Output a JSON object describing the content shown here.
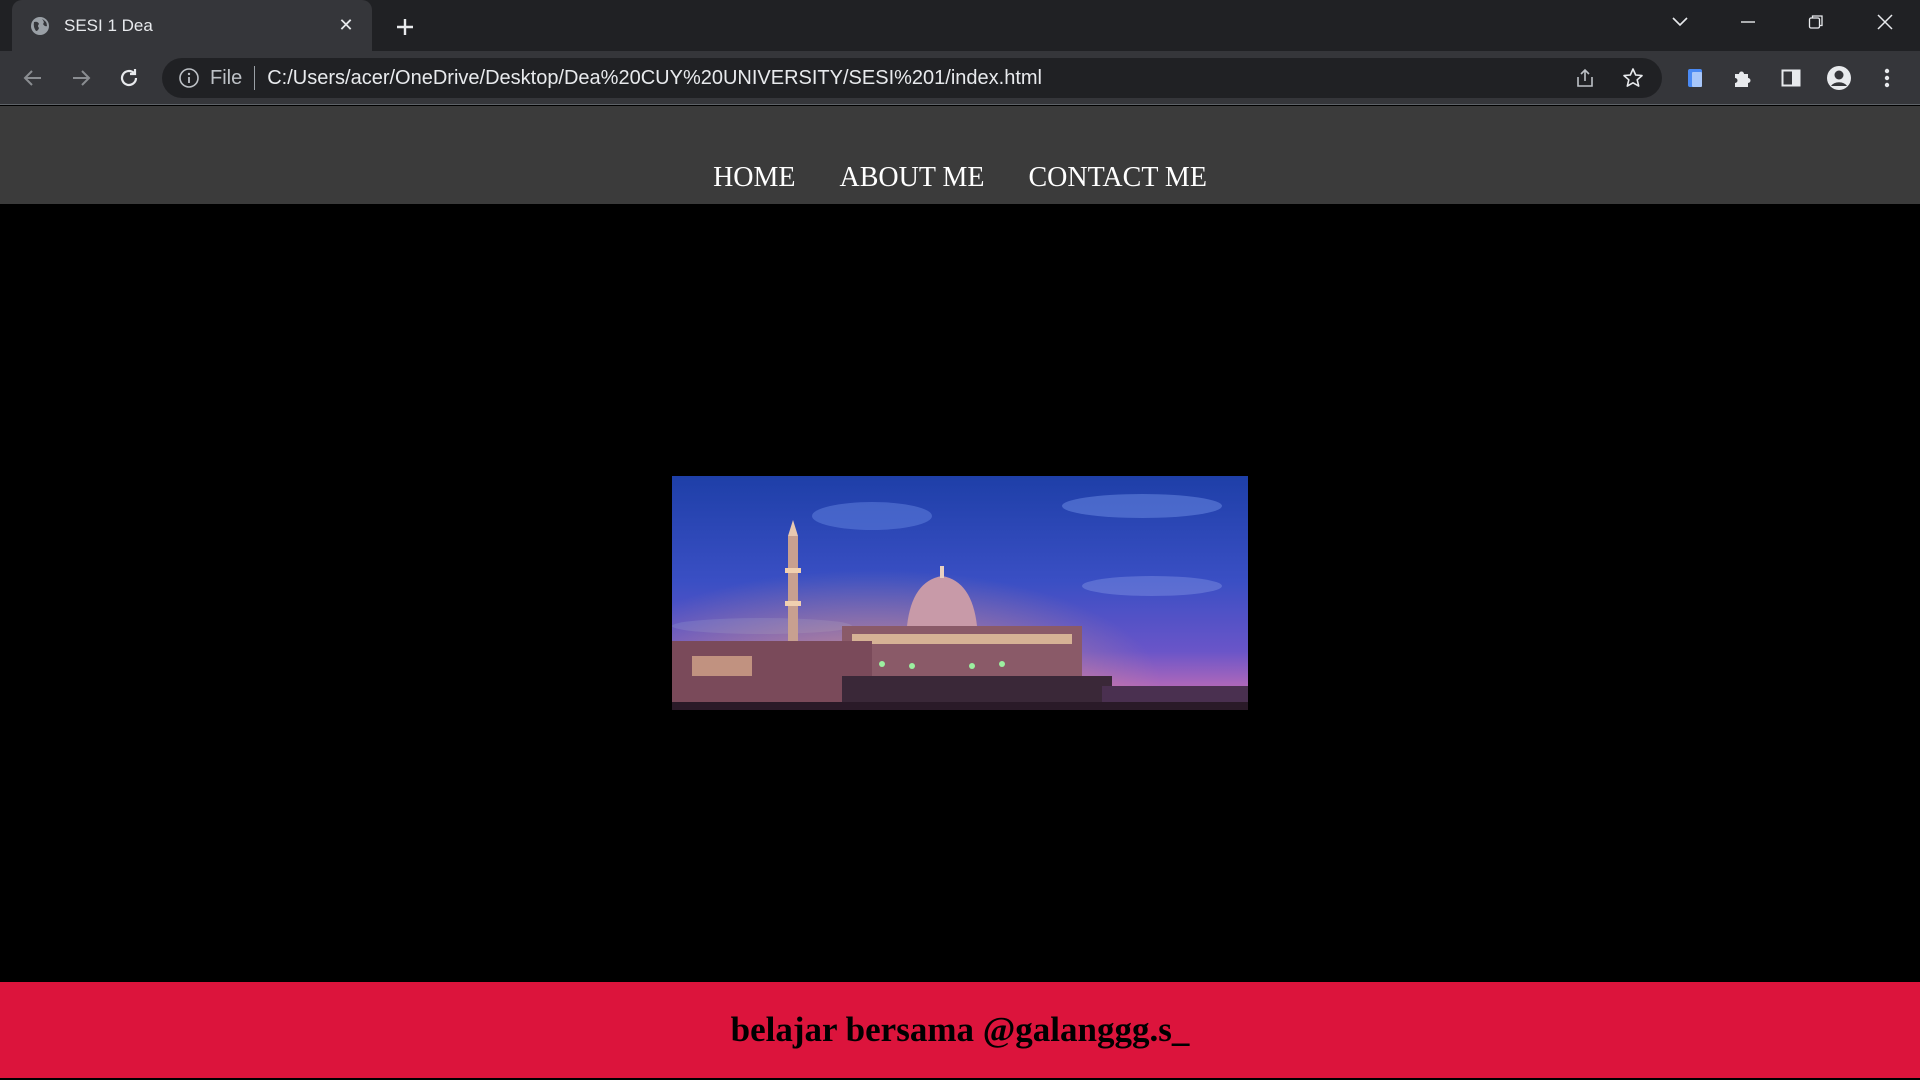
{
  "browser": {
    "tab_title": "SESI 1 Dea",
    "scheme_label": "File",
    "url": "C:/Users/acer/OneDrive/Desktop/Dea%20CUY%20UNIVERSITY/SESI%201/index.html"
  },
  "nav": {
    "items": [
      {
        "label": "HOME"
      },
      {
        "label": "ABOUT ME"
      },
      {
        "label": "CONTACT ME"
      }
    ]
  },
  "hero": {
    "image_alt": "mosque at dusk"
  },
  "footer": {
    "text": "belajar bersama @galanggg.s_"
  },
  "colors": {
    "nav_bg": "#3b3b3b",
    "page_bg": "#000000",
    "footer_bg": "#dc143c"
  }
}
